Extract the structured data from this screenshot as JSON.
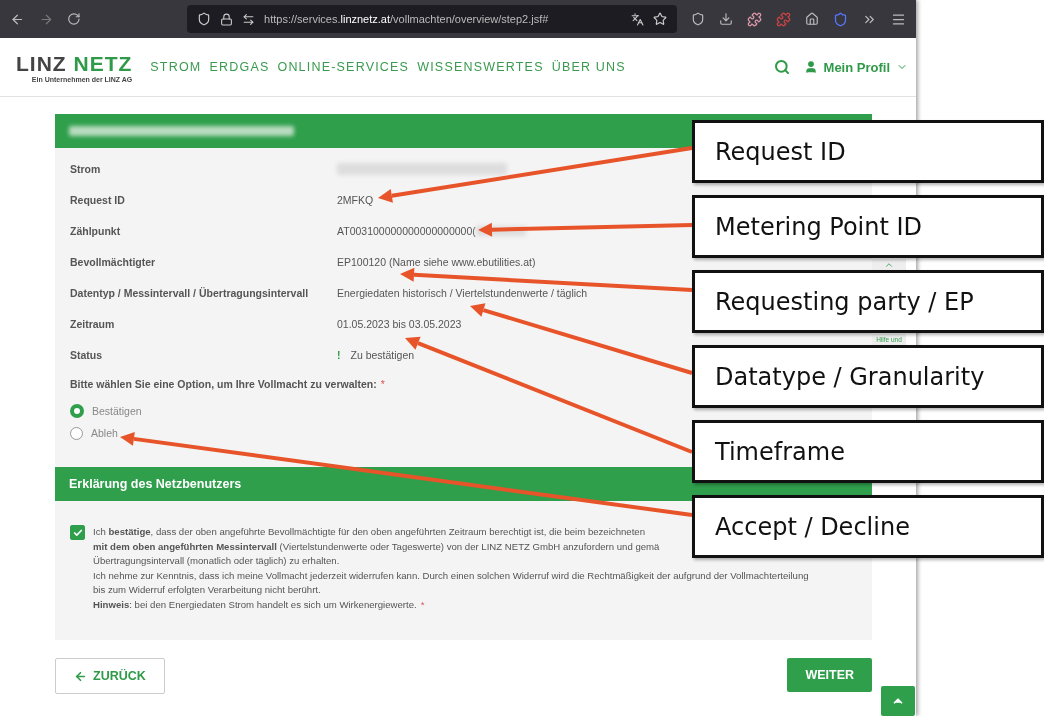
{
  "browser": {
    "url": "https://services.**linznetz.at**/vollmachten/overview/step2.jsf#"
  },
  "header": {
    "logo_left": "LINZ",
    "logo_right": "NETZ",
    "tagline": "Ein Unternehmen der LINZ AG",
    "nav": [
      "STROM",
      "ERDGAS",
      "ONLINE-SERVICES",
      "WISSENSWERTES",
      "ÜBER UNS"
    ],
    "profile": "Mein Profil"
  },
  "details": {
    "rows": [
      {
        "label": "Strom",
        "kind": "redacted"
      },
      {
        "label": "Request ID",
        "kind": "text",
        "value": "2MFKQ"
      },
      {
        "label": "Zählpunkt",
        "kind": "partly",
        "value": "AT003100000000000000000("
      },
      {
        "label": "Bevollmächtigter",
        "kind": "text",
        "value": "EP100120 (Name siehe www.ebutilities.at)"
      },
      {
        "label": "Datentyp / Messintervall / Übertragungsintervall",
        "kind": "text",
        "value": "Energiedaten historisch / Viertelstundenwerte / täglich"
      },
      {
        "label": "Zeitraum",
        "kind": "text",
        "value": "01.05.2023 bis 03.05.2023"
      },
      {
        "label": "Status",
        "kind": "status",
        "icon": "!",
        "value": "Zu bestätigen"
      }
    ],
    "question": "Bitte wählen Sie eine Option, um Ihre Vollmacht zu verwalten:",
    "required": "*",
    "options": [
      {
        "label": "Bestätigen",
        "selected": true
      },
      {
        "label": "Ableh",
        "selected": false
      }
    ]
  },
  "declaration": {
    "title": "Erklärung des Netzbenutzers",
    "checked": true,
    "lines": [
      "Ich **bestätige**, dass der oben angeführte Bevollmächtigte für den oben angeführten Zeitraum berechtigt ist, die beim bezeichneten",
      "**mit dem oben angeführten Messintervall** (Viertelstundenwerte oder Tageswerte) von der LINZ NETZ GmbH anzufordern und gemä",
      "Übertragungsintervall (monatlich oder täglich) zu erhalten.",
      "Ich nehme zur Kenntnis, dass ich meine Vollmacht jederzeit widerrufen kann. Durch einen solchen Widerruf wird die Rechtmäßigkeit der aufgrund der Vollmachterteilung",
      "bis zum Widerruf erfolgten Verarbeitung nicht berührt.",
      "**Hinweis**: bei den Energiedaten Strom handelt es sich um Wirkenergiewerte."
    ],
    "required": "*"
  },
  "buttons": {
    "back": "ZURÜCK",
    "next": "WEITER"
  },
  "side_tab": {
    "label": "Hilfe und"
  },
  "callouts": [
    "Request ID",
    "Metering Point ID",
    "Requesting party / EP",
    "Datatype / Granularity",
    "Timeframe",
    "Accept / Decline"
  ]
}
